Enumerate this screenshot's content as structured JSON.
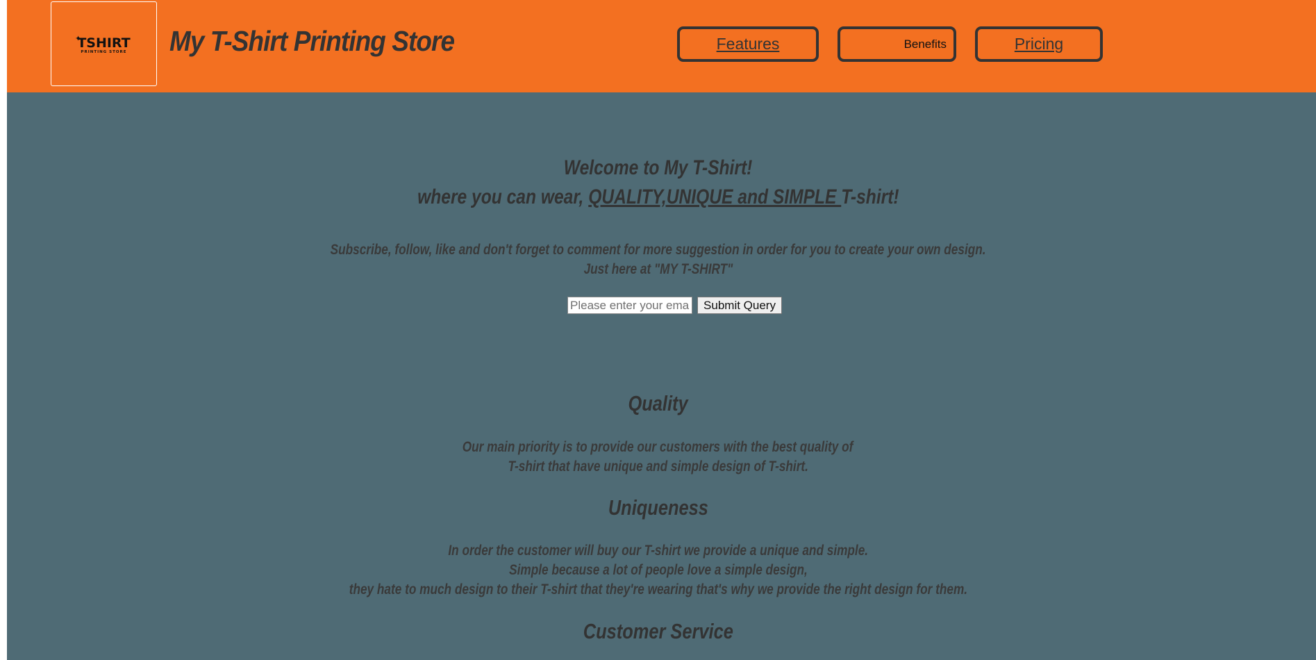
{
  "header": {
    "logo": {
      "word": "TSHIRT",
      "subtext": "PRINTING STORE"
    },
    "title": "My T-Shirt Printing Store",
    "nav": [
      {
        "label": "Features"
      },
      {
        "label": "Benefits"
      },
      {
        "label": "Pricing"
      }
    ]
  },
  "hero": {
    "line1": "Welcome to My T-Shirt!",
    "line2_prefix": "where you can wear, ",
    "line2_emphasis": "QUALITY,UNIQUE and SIMPLE ",
    "line2_suffix": "T-shirt!",
    "subscribe_line1": "Subscribe, follow, like and don't forget to comment for more suggestion in order for you to create your own design.",
    "subscribe_line2": "Just here at \"MY T-SHIRT\""
  },
  "form": {
    "email_placeholder": "Please enter your email",
    "email_value": "",
    "submit_label": "Submit Query"
  },
  "sections": {
    "quality": {
      "heading": "Quality",
      "line1": "Our main priority is to provide our customers with the best quality of",
      "line2": "T-shirt that have unique and simple design of T-shirt."
    },
    "uniqueness": {
      "heading": "Uniqueness",
      "line1": "In order the customer will buy our T-shirt we provide a unique and simple.",
      "line2": "Simple because a lot of people love a simple design,",
      "line3": "they hate to much design to their T-shirt that they're wearing that's why we provide the right design for them."
    },
    "customer_service": {
      "heading": "Customer Service"
    }
  },
  "colors": {
    "header_bg": "#f37021",
    "page_bg": "#4f6b75",
    "text": "#333333"
  }
}
